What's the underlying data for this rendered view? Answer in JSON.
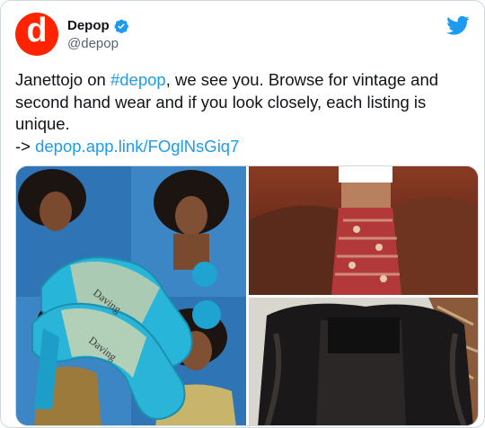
{
  "tweet": {
    "author": {
      "display_name": "Depop",
      "handle": "@depop",
      "avatar_letter": "d",
      "avatar_color": "#ff2300",
      "verified": true
    },
    "text": {
      "part1": "Janettojo on ",
      "hashtag": "#depop",
      "part2": ", we see you. Browse for vintage and second hand wear and if you look closely, each listing is unique.",
      "arrow": "-> ",
      "link": "depop.app.link/FOglNsGiq7"
    },
    "media": {
      "shoe_brand": "Daving",
      "images": [
        {
          "name": "clear-heel-mules-collage",
          "icon": "photo"
        },
        {
          "name": "paisley-skirt-photo",
          "icon": "photo"
        },
        {
          "name": "faux-fur-jacket-photo",
          "icon": "photo"
        }
      ]
    },
    "colors": {
      "link": "#1d9bf0",
      "twitter_blue": "#1d9bf0",
      "text": "#0f1419",
      "muted": "#536471"
    }
  }
}
